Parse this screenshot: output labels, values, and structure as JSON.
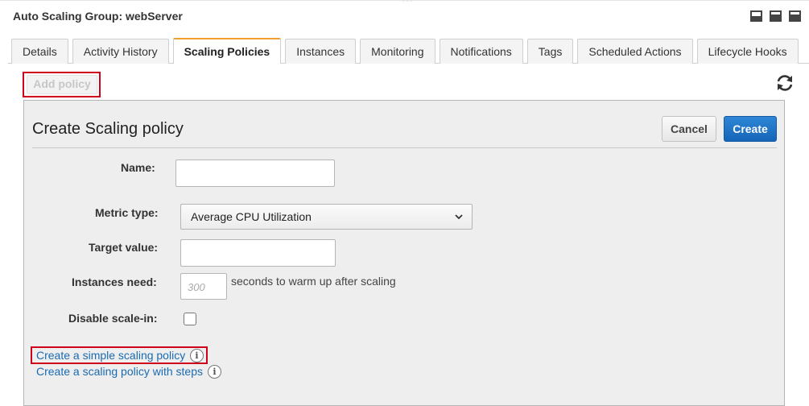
{
  "window": {
    "title": "Auto Scaling Group: webServer",
    "drag_handle": "˙˙˙"
  },
  "tabs": [
    {
      "label": "Details"
    },
    {
      "label": "Activity History"
    },
    {
      "label": "Scaling Policies",
      "active": true
    },
    {
      "label": "Instances"
    },
    {
      "label": "Monitoring"
    },
    {
      "label": "Notifications"
    },
    {
      "label": "Tags"
    },
    {
      "label": "Scheduled Actions"
    },
    {
      "label": "Lifecycle Hooks"
    }
  ],
  "toolbar": {
    "add_policy_label": "Add policy",
    "refresh_icon": "refresh-icon"
  },
  "panel": {
    "title": "Create Scaling policy",
    "cancel_label": "Cancel",
    "create_label": "Create",
    "fields": {
      "name_label": "Name:",
      "name_value": "",
      "metric_label": "Metric type:",
      "metric_value": "Average CPU Utilization",
      "target_label": "Target value:",
      "target_value": "",
      "warmup_label": "Instances need:",
      "warmup_placeholder": "300",
      "warmup_suffix": "seconds to warm up after scaling",
      "disable_label": "Disable scale-in:",
      "disable_checked": false
    },
    "links": {
      "simple_policy": "Create a simple scaling policy",
      "steps_policy": "Create a scaling policy with steps",
      "info_glyph": "i"
    }
  },
  "colors": {
    "accent_tab": "#f0a030",
    "primary_button": "#1f75c8",
    "link": "#1a6bb0",
    "highlight_box": "#d0021b"
  }
}
